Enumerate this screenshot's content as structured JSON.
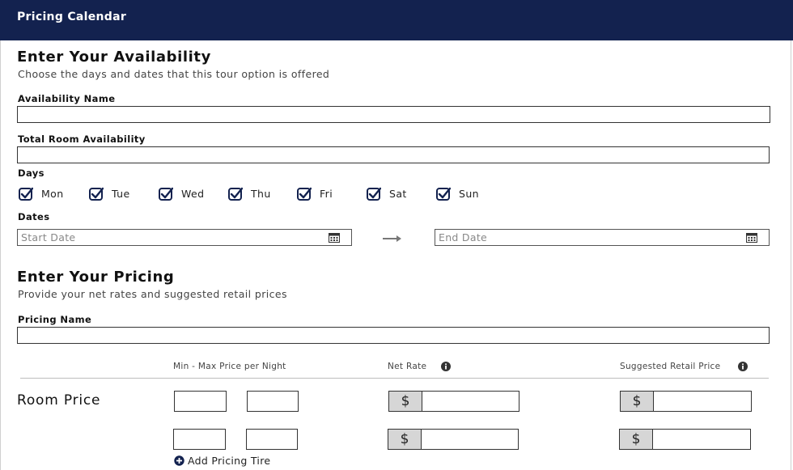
{
  "app": {
    "title": "Pricing Calendar"
  },
  "availability": {
    "heading": "Enter Your Availability",
    "subtitle": "Choose the days and dates that this tour option is offered",
    "name_label": "Availability Name",
    "name_value": "",
    "room_label": "Total Room Availability",
    "room_value": "",
    "days_label": "Days",
    "days": [
      {
        "label": "Mon",
        "checked": true
      },
      {
        "label": "Tue",
        "checked": true
      },
      {
        "label": "Wed",
        "checked": true
      },
      {
        "label": "Thu",
        "checked": true
      },
      {
        "label": "Fri",
        "checked": true
      },
      {
        "label": "Sat",
        "checked": true
      },
      {
        "label": "Sun",
        "checked": true
      }
    ],
    "dates_label": "Dates",
    "start_placeholder": "Start Date",
    "end_placeholder": "End Date"
  },
  "pricing": {
    "heading": "Enter Your Pricing",
    "subtitle": "Provide your net rates and suggested retail prices",
    "name_label": "Pricing Name",
    "name_value": "",
    "col_minmax": "Min - Max Price per Night",
    "col_net": "Net Rate",
    "col_retail": "Suggested Retail Price",
    "row_label": "Room Price",
    "currency": "$",
    "add_tier": "Add Pricing Tire"
  },
  "colors": {
    "titlebar": "#13224f",
    "checkbox": "#13224f",
    "currency_bg": "#d6d6d6"
  },
  "icons": [
    "checkbox-checked-icon",
    "calendar-icon",
    "arrow-right-icon",
    "info-icon",
    "plus-circle-icon"
  ]
}
